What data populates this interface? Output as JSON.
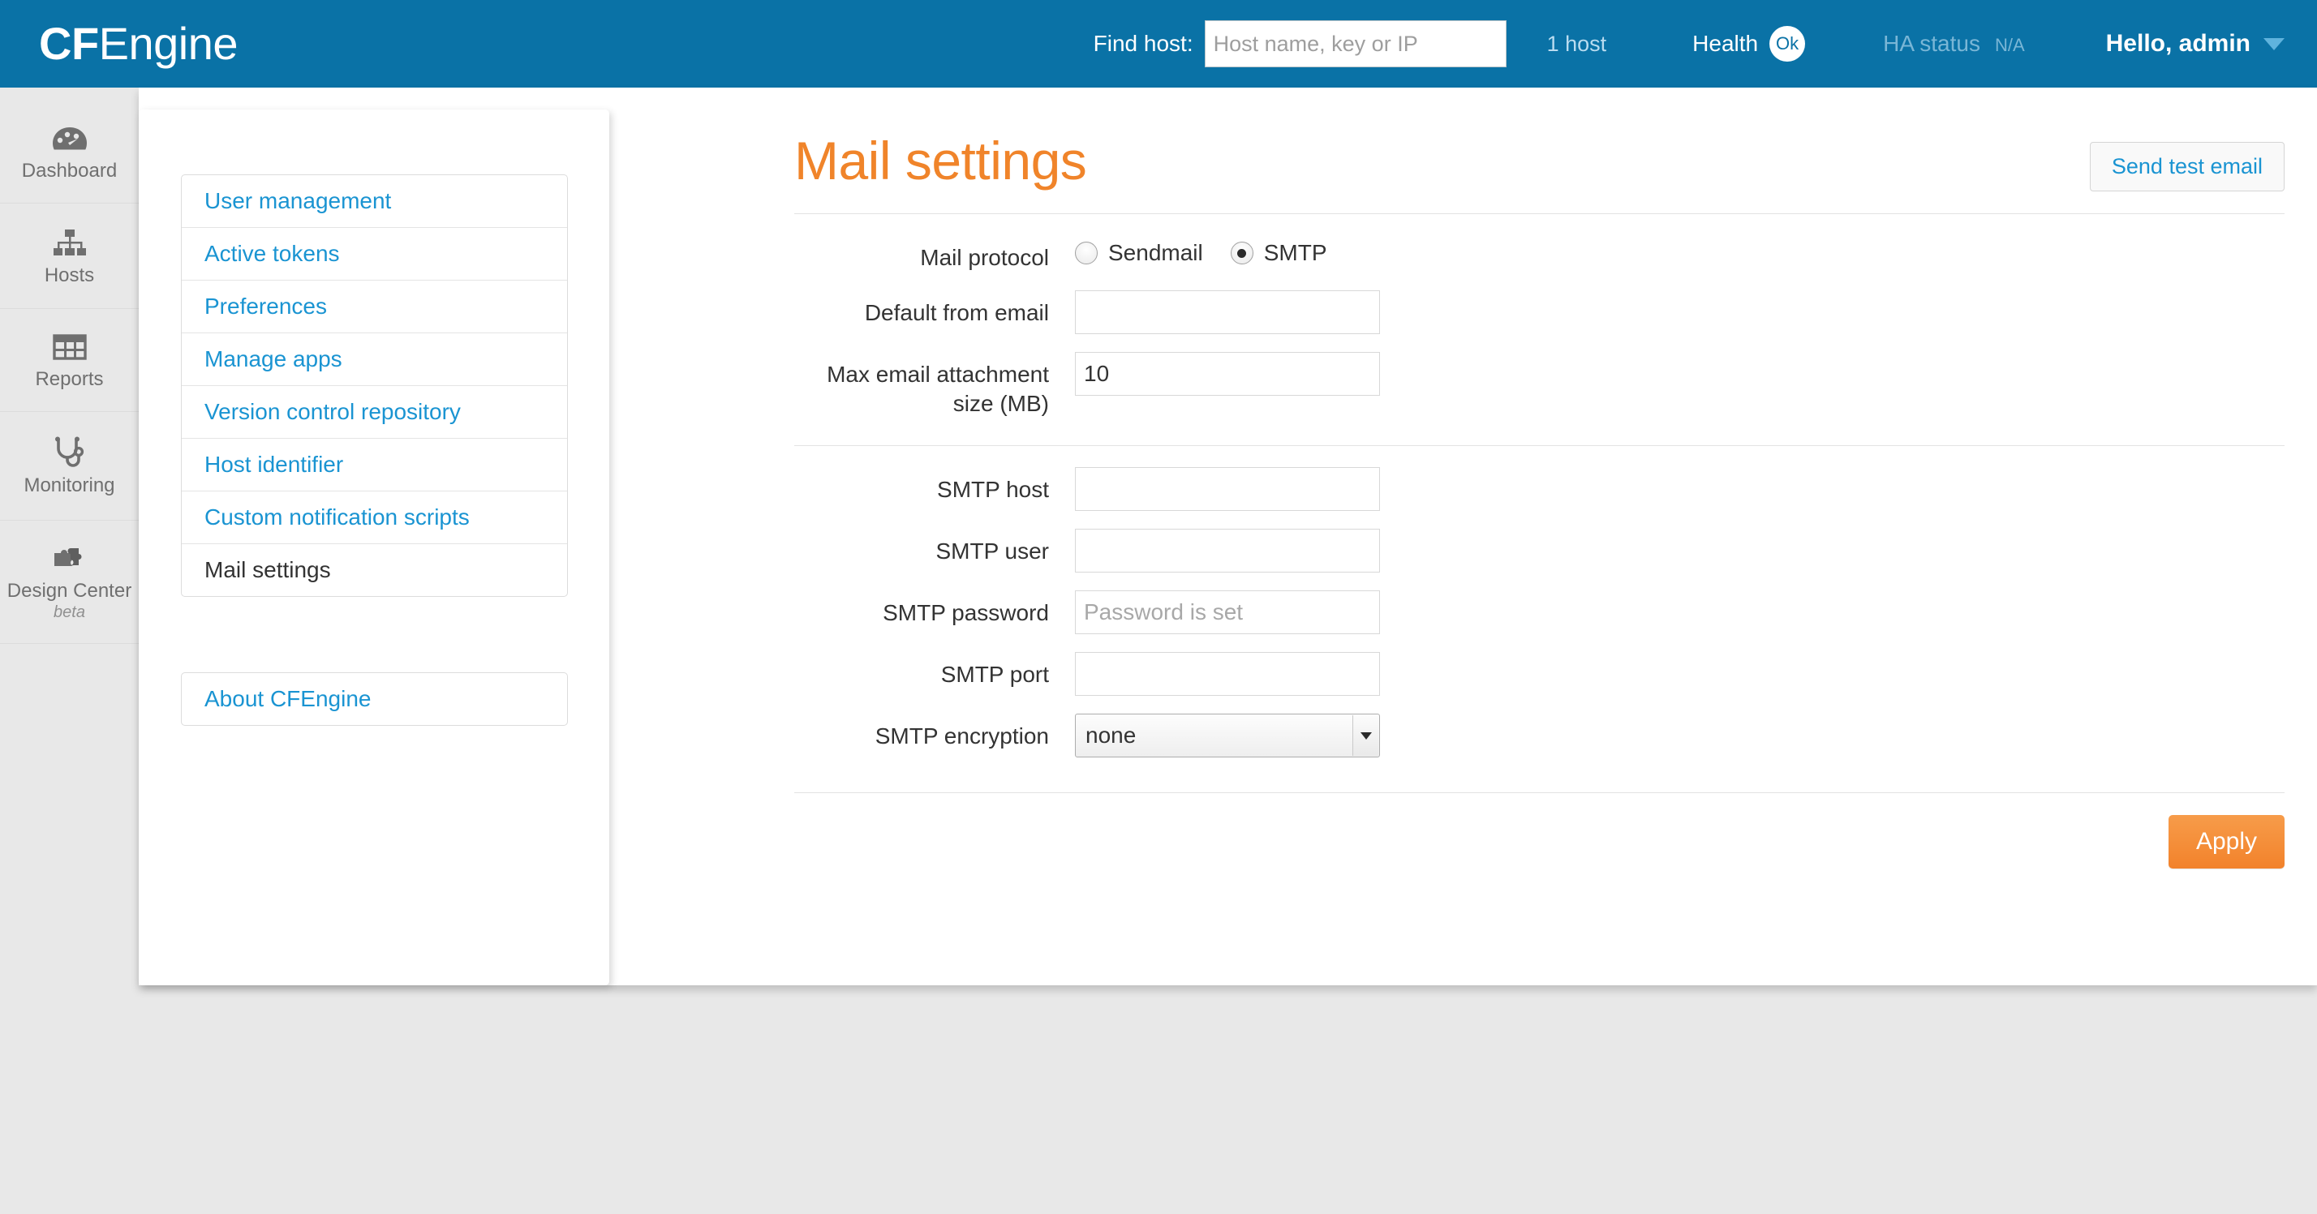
{
  "brand": {
    "prefix": "CF",
    "suffix": "Engine"
  },
  "topbar": {
    "find_host_label": "Find host:",
    "find_host_placeholder": "Host name, key or IP",
    "find_host_value": "",
    "host_count": "1 host",
    "health_label": "Health",
    "health_status": "Ok",
    "ha_label": "HA status",
    "ha_value": "N/A",
    "user_greeting": "Hello, admin",
    "accent_blue": "#0a72a6"
  },
  "rail": {
    "items": [
      {
        "label": "Dashboard",
        "icon": "dashboard-icon",
        "sub": ""
      },
      {
        "label": "Hosts",
        "icon": "sitemap-icon",
        "sub": ""
      },
      {
        "label": "Reports",
        "icon": "table-icon",
        "sub": ""
      },
      {
        "label": "Monitoring",
        "icon": "stethoscope-icon",
        "sub": ""
      },
      {
        "label": "Design Center",
        "icon": "puzzle-icon",
        "sub": "beta"
      }
    ]
  },
  "settings_menu": {
    "items": [
      {
        "label": "User management",
        "active": false
      },
      {
        "label": "Active tokens",
        "active": false
      },
      {
        "label": "Preferences",
        "active": false
      },
      {
        "label": "Manage apps",
        "active": false
      },
      {
        "label": "Version control repository",
        "active": false
      },
      {
        "label": "Host identifier",
        "active": false
      },
      {
        "label": "Custom notification scripts",
        "active": false
      },
      {
        "label": "Mail settings",
        "active": true
      }
    ],
    "about_label": "About CFEngine"
  },
  "main": {
    "title": "Mail settings",
    "title_color": "#f0842a",
    "send_test_email_label": "Send test email",
    "apply_label": "Apply",
    "mail_protocol": {
      "label": "Mail protocol",
      "options": [
        {
          "label": "Sendmail",
          "checked": false
        },
        {
          "label": "SMTP",
          "checked": true
        }
      ]
    },
    "fields": {
      "default_from_email": {
        "label": "Default from email",
        "value": "",
        "placeholder": ""
      },
      "max_attachment_size": {
        "label": "Max email attachment size (MB)",
        "value": "10",
        "placeholder": ""
      },
      "smtp_host": {
        "label": "SMTP host",
        "value": "",
        "placeholder": ""
      },
      "smtp_user": {
        "label": "SMTP user",
        "value": "",
        "placeholder": ""
      },
      "smtp_password": {
        "label": "SMTP password",
        "value": "",
        "placeholder": "Password is set"
      },
      "smtp_port": {
        "label": "SMTP port",
        "value": "",
        "placeholder": ""
      },
      "smtp_encryption": {
        "label": "SMTP encryption",
        "value": "none",
        "options": [
          "none"
        ]
      }
    }
  }
}
